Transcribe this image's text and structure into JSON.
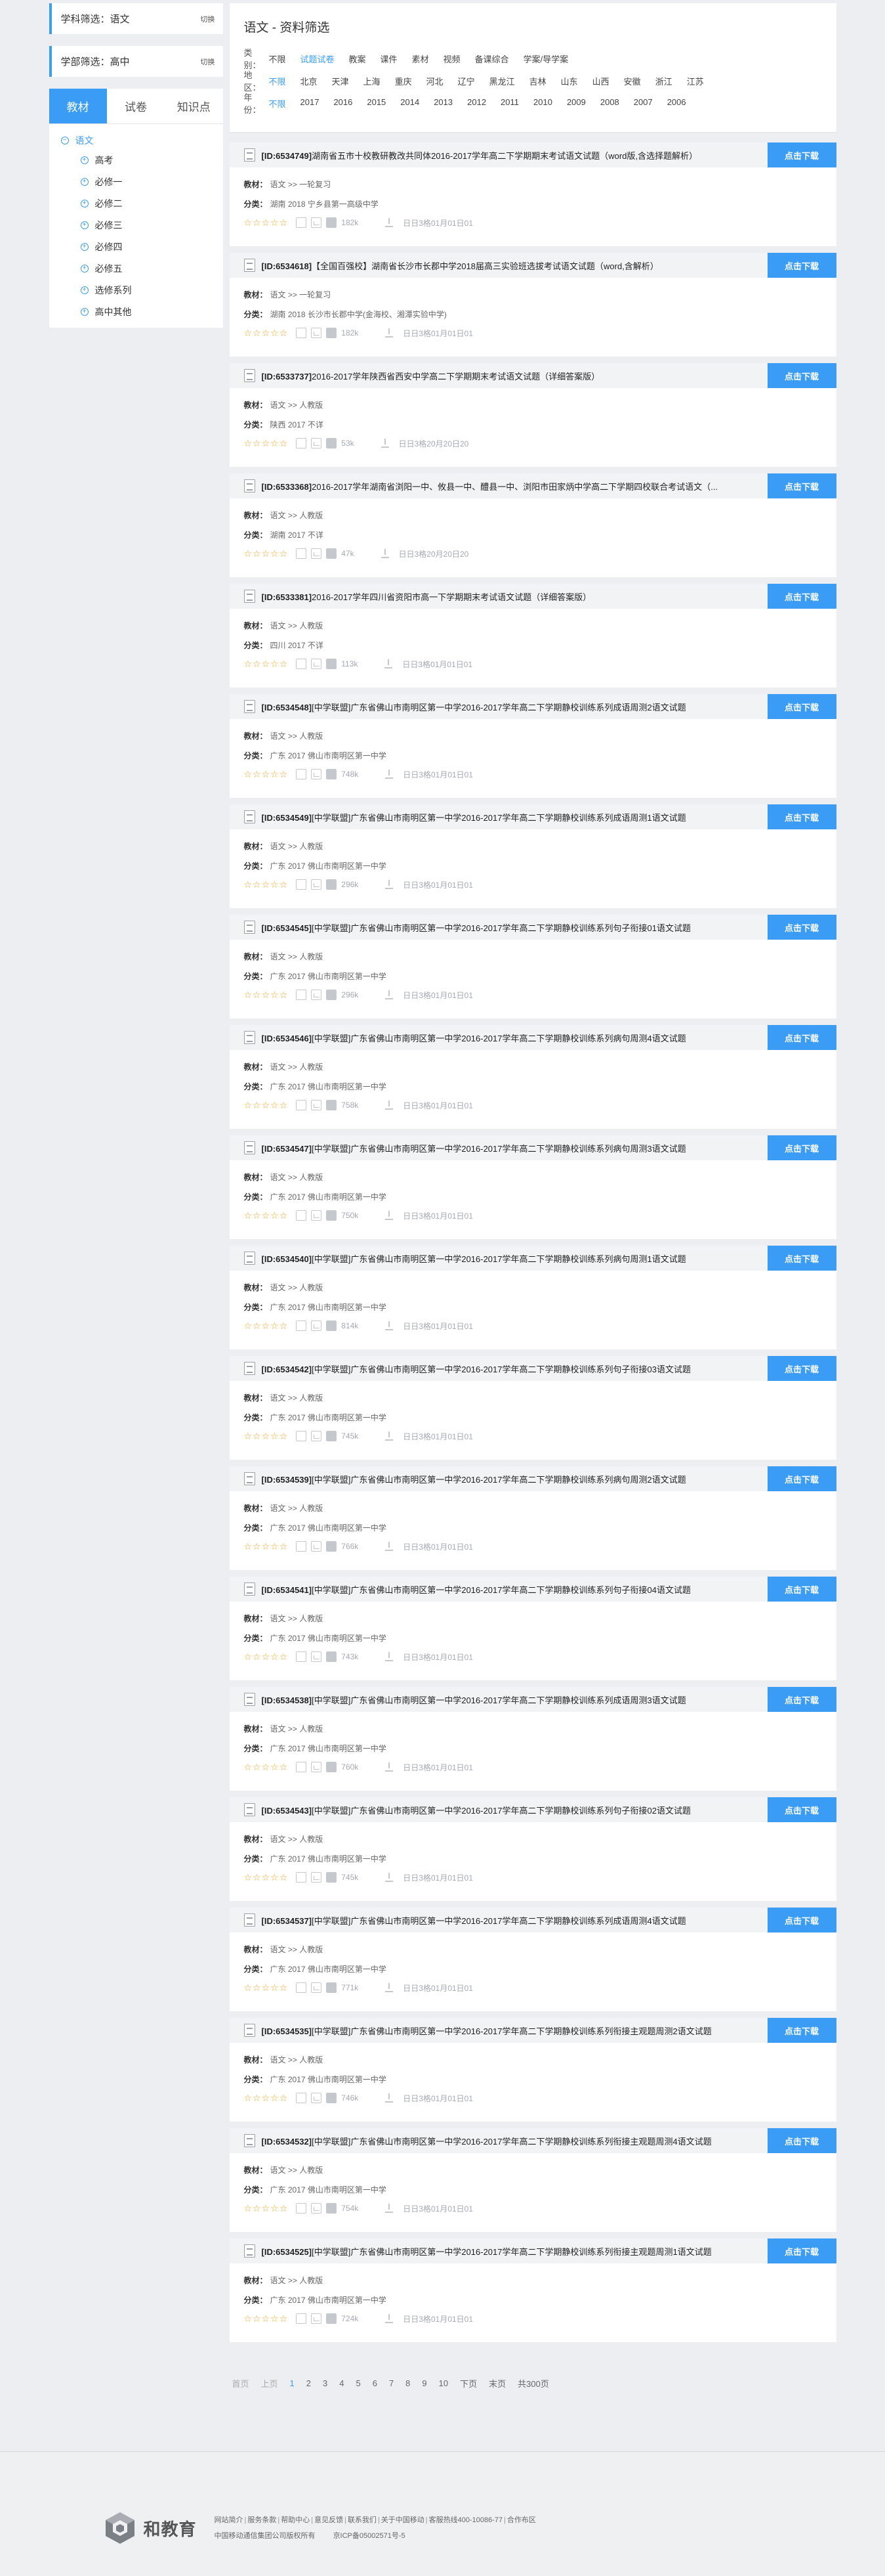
{
  "subject_filter": {
    "label": "学科筛选：语文",
    "switch": "切换"
  },
  "stage_filter": {
    "label": "学部筛选：高中",
    "switch": "切换"
  },
  "left_tabs": [
    "教材",
    "试卷",
    "知识点"
  ],
  "tree": {
    "root": "语文",
    "children": [
      "高考",
      "必修一",
      "必修二",
      "必修三",
      "必修四",
      "必修五",
      "选修系列",
      "高中其他"
    ]
  },
  "filter": {
    "title": "语文 - 资料筛选",
    "category": {
      "label": "类别：",
      "options": [
        "不限",
        "试题试卷",
        "教案",
        "课件",
        "素材",
        "视频",
        "备课综合",
        "学案/导学案"
      ],
      "selected": 1
    },
    "region": {
      "label": "地区：",
      "options": [
        "不限",
        "北京",
        "天津",
        "上海",
        "重庆",
        "河北",
        "辽宁",
        "黑龙江",
        "吉林",
        "山东",
        "山西",
        "安徽",
        "浙江",
        "江苏"
      ],
      "selected": 0
    },
    "year": {
      "label": "年份：",
      "options": [
        "不限",
        "2017",
        "2016",
        "2015",
        "2014",
        "2013",
        "2012",
        "2011",
        "2010",
        "2009",
        "2008",
        "2007",
        "2006"
      ],
      "selected": 0
    }
  },
  "labels": {
    "download": "点击下载",
    "material": "教材：",
    "class": "分类："
  },
  "items": [
    {
      "id": "[ID:6534749]",
      "title": "湖南省五市十校教研教改共同体2016-2017学年高二下学期期末考试语文试题（word版,含选择题解析）",
      "material": "语文 >> 一轮复习",
      "class": "湖南 2018 宁乡县第一高级中学",
      "size": "182k",
      "date": "日日3格01月01日01"
    },
    {
      "id": "[ID:6534618]",
      "title": "【全国百强校】湖南省长沙市长郡中学2018届高三实验班选拔考试语文试题（word,含解析）",
      "material": "语文 >> 一轮复习",
      "class": "湖南 2018 长沙市长郡中学(金海校、湘潭实验中学)",
      "size": "182k",
      "date": "日日3格01月01日01"
    },
    {
      "id": "[ID:6533737]",
      "title": "2016-2017学年陕西省西安中学高二下学期期末考试语文试题（详细答案版）",
      "material": "语文 >> 人教版",
      "class": "陕西 2017 不详",
      "size": "53k",
      "date": "日日3格20月20日20"
    },
    {
      "id": "[ID:6533368]",
      "title": "2016-2017学年湖南省浏阳一中、攸县一中、醴县一中、浏阳市田家炳中学高二下学期四校联合考试语文（...",
      "material": "语文 >> 人教版",
      "class": "湖南 2017 不详",
      "size": "47k",
      "date": "日日3格20月20日20"
    },
    {
      "id": "[ID:6533381]",
      "title": "2016-2017学年四川省资阳市高一下学期期末考试语文试题（详细答案版）",
      "material": "语文 >> 人教版",
      "class": "四川 2017 不详",
      "size": "113k",
      "date": "日日3格01月01日01"
    },
    {
      "id": "[ID:6534548]",
      "title": "[中学联盟]广东省佛山市南明区第一中学2016-2017学年高二下学期静校训练系列成语周测2语文试题",
      "material": "语文 >> 人教版",
      "class": "广东 2017 佛山市南明区第一中学",
      "size": "748k",
      "date": "日日3格01月01日01"
    },
    {
      "id": "[ID:6534549]",
      "title": "[中学联盟]广东省佛山市南明区第一中学2016-2017学年高二下学期静校训练系列成语周测1语文试题",
      "material": "语文 >> 人教版",
      "class": "广东 2017 佛山市南明区第一中学",
      "size": "296k",
      "date": "日日3格01月01日01"
    },
    {
      "id": "[ID:6534545]",
      "title": "[中学联盟]广东省佛山市南明区第一中学2016-2017学年高二下学期静校训练系列句子衔接01语文试题",
      "material": "语文 >> 人教版",
      "class": "广东 2017 佛山市南明区第一中学",
      "size": "296k",
      "date": "日日3格01月01日01"
    },
    {
      "id": "[ID:6534546]",
      "title": "[中学联盟]广东省佛山市南明区第一中学2016-2017学年高二下学期静校训练系列病句周测4语文试题",
      "material": "语文 >> 人教版",
      "class": "广东 2017 佛山市南明区第一中学",
      "size": "758k",
      "date": "日日3格01月01日01"
    },
    {
      "id": "[ID:6534547]",
      "title": "[中学联盟]广东省佛山市南明区第一中学2016-2017学年高二下学期静校训练系列病句周测3语文试题",
      "material": "语文 >> 人教版",
      "class": "广东 2017 佛山市南明区第一中学",
      "size": "750k",
      "date": "日日3格01月01日01"
    },
    {
      "id": "[ID:6534540]",
      "title": "[中学联盟]广东省佛山市南明区第一中学2016-2017学年高二下学期静校训练系列病句周测1语文试题",
      "material": "语文 >> 人教版",
      "class": "广东 2017 佛山市南明区第一中学",
      "size": "814k",
      "date": "日日3格01月01日01"
    },
    {
      "id": "[ID:6534542]",
      "title": "[中学联盟]广东省佛山市南明区第一中学2016-2017学年高二下学期静校训练系列句子衔接03语文试题",
      "material": "语文 >> 人教版",
      "class": "广东 2017 佛山市南明区第一中学",
      "size": "745k",
      "date": "日日3格01月01日01"
    },
    {
      "id": "[ID:6534539]",
      "title": "[中学联盟]广东省佛山市南明区第一中学2016-2017学年高二下学期静校训练系列病句周测2语文试题",
      "material": "语文 >> 人教版",
      "class": "广东 2017 佛山市南明区第一中学",
      "size": "766k",
      "date": "日日3格01月01日01"
    },
    {
      "id": "[ID:6534541]",
      "title": "[中学联盟]广东省佛山市南明区第一中学2016-2017学年高二下学期静校训练系列句子衔接04语文试题",
      "material": "语文 >> 人教版",
      "class": "广东 2017 佛山市南明区第一中学",
      "size": "743k",
      "date": "日日3格01月01日01"
    },
    {
      "id": "[ID:6534538]",
      "title": "[中学联盟]广东省佛山市南明区第一中学2016-2017学年高二下学期静校训练系列成语周测3语文试题",
      "material": "语文 >> 人教版",
      "class": "广东 2017 佛山市南明区第一中学",
      "size": "760k",
      "date": "日日3格01月01日01"
    },
    {
      "id": "[ID:6534543]",
      "title": "[中学联盟]广东省佛山市南明区第一中学2016-2017学年高二下学期静校训练系列句子衔接02语文试题",
      "material": "语文 >> 人教版",
      "class": "广东 2017 佛山市南明区第一中学",
      "size": "745k",
      "date": "日日3格01月01日01"
    },
    {
      "id": "[ID:6534537]",
      "title": "[中学联盟]广东省佛山市南明区第一中学2016-2017学年高二下学期静校训练系列成语周测4语文试题",
      "material": "语文 >> 人教版",
      "class": "广东 2017 佛山市南明区第一中学",
      "size": "771k",
      "date": "日日3格01月01日01"
    },
    {
      "id": "[ID:6534535]",
      "title": "[中学联盟]广东省佛山市南明区第一中学2016-2017学年高二下学期静校训练系列衔接主观题周测2语文试题",
      "material": "语文 >> 人教版",
      "class": "广东 2017 佛山市南明区第一中学",
      "size": "746k",
      "date": "日日3格01月01日01"
    },
    {
      "id": "[ID:6534532]",
      "title": "[中学联盟]广东省佛山市南明区第一中学2016-2017学年高二下学期静校训练系列衔接主观题周测4语文试题",
      "material": "语文 >> 人教版",
      "class": "广东 2017 佛山市南明区第一中学",
      "size": "754k",
      "date": "日日3格01月01日01"
    },
    {
      "id": "[ID:6534525]",
      "title": "[中学联盟]广东省佛山市南明区第一中学2016-2017学年高二下学期静校训练系列衔接主观题周测1语文试题",
      "material": "语文 >> 人教版",
      "class": "广东 2017 佛山市南明区第一中学",
      "size": "724k",
      "date": "日日3格01月01日01"
    }
  ],
  "pager": {
    "first": "首页",
    "prev": "上页",
    "pages": [
      "1",
      "2",
      "3",
      "4",
      "5",
      "6",
      "7",
      "8",
      "9",
      "10"
    ],
    "current": 0,
    "next": "下页",
    "last": "末页",
    "total": "共300页"
  },
  "footer": {
    "brand": "和教育",
    "links": [
      "网站简介",
      "服务条款",
      "帮助中心",
      "意见反馈",
      "联系我们",
      "关于中国移动",
      "客服热线400-10086-77",
      "合作布区"
    ],
    "company": "中国移动通信集团公司版权所有",
    "icp": "京ICP备05002571号-5"
  },
  "colors": {
    "accent": "#3a9cf4",
    "star": "#f5a623",
    "page_bg": "#eceef1"
  }
}
